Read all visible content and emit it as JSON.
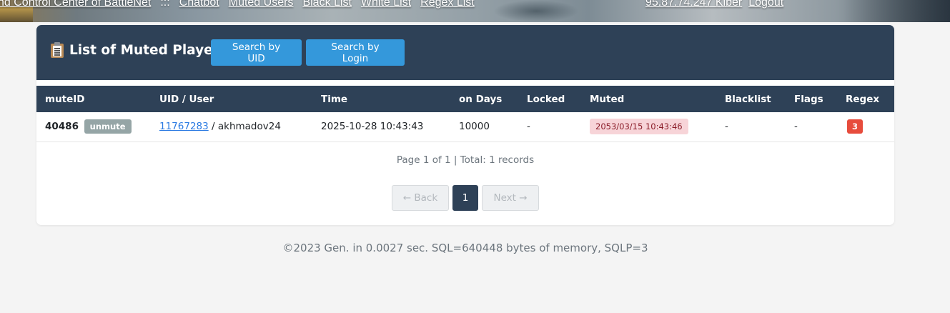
{
  "topnav": {
    "title": "nd Control Center of BattleNet",
    "separator": ":::",
    "links": [
      "Chatbot",
      "Muted Users",
      "Black List",
      "White List",
      "Regex List"
    ],
    "ip_user": "95.87.74.247 Kiber",
    "logout": "Logout"
  },
  "card": {
    "title": "List of Muted Players",
    "buttons": {
      "search_uid": "Search by UID",
      "search_login": "Search by Login"
    }
  },
  "table": {
    "headers": [
      "muteID",
      "UID / User",
      "Time",
      "on Days",
      "Locked",
      "Muted",
      "Blacklist",
      "Flags",
      "Regex"
    ],
    "rows": [
      {
        "mute_id": "40486",
        "unmute_label": "unmute",
        "uid": "11767283",
        "user": " / akhmadov24",
        "time": "2025-10-28 10:43:43",
        "on_days": "10000",
        "locked": "-",
        "muted": "2053/03/15 10:43:46",
        "blacklist": "-",
        "flags": "-",
        "regex": "3"
      }
    ]
  },
  "pagination": {
    "info": "Page 1 of 1 | Total: 1 records",
    "back": "← Back",
    "current": "1",
    "next": "Next →"
  },
  "footer": "©2023 Gen. in 0.0027 sec. SQL=640448 bytes of memory, SQLP=3",
  "colors": {
    "header_bg": "#2e4157",
    "button_blue": "#3498db",
    "regex_badge": "#e74c3c",
    "muted_badge_bg": "#f7d4d8",
    "unmute_badge": "#95a5a6"
  }
}
